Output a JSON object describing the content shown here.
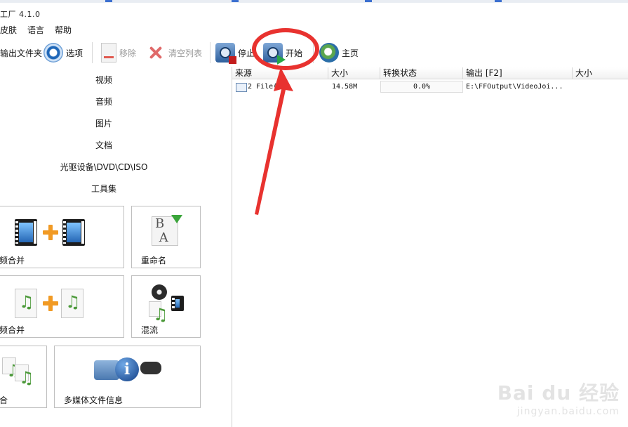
{
  "window": {
    "title": "工厂 4.1.0"
  },
  "menu": {
    "items": [
      "皮肤",
      "语言",
      "帮助"
    ]
  },
  "toolbar": {
    "output_folder": "输出文件夹",
    "options": "选项",
    "remove": "移除",
    "clear_list": "清空列表",
    "stop": "停止",
    "start": "开始",
    "home": "主页"
  },
  "categories": [
    "视频",
    "音频",
    "图片",
    "文档",
    "光驱设备\\DVD\\CD\\ISO",
    "工具集"
  ],
  "tools": {
    "video_join": "频合并",
    "rename": "重命名",
    "audio_join": "频合并",
    "mux": "混流",
    "merge": "合",
    "media_info": "多媒体文件信息"
  },
  "list": {
    "columns": [
      "来源",
      "大小",
      "转换状态",
      "输出 [F2]",
      "大小"
    ],
    "rows": [
      {
        "source": "2 File(s",
        "size": "14.58M",
        "status": "0.0%",
        "progress": 0.0,
        "output": "E:\\FFOutput\\VideoJoi...",
        "out_size": ""
      }
    ]
  },
  "watermark": {
    "brand": "Bai du 经验",
    "url": "jingyan.baidu.com"
  },
  "colors": {
    "annotation": "#e8322f",
    "stop": "#c31d1d",
    "play": "#28a745",
    "plus": "#f19a24"
  }
}
